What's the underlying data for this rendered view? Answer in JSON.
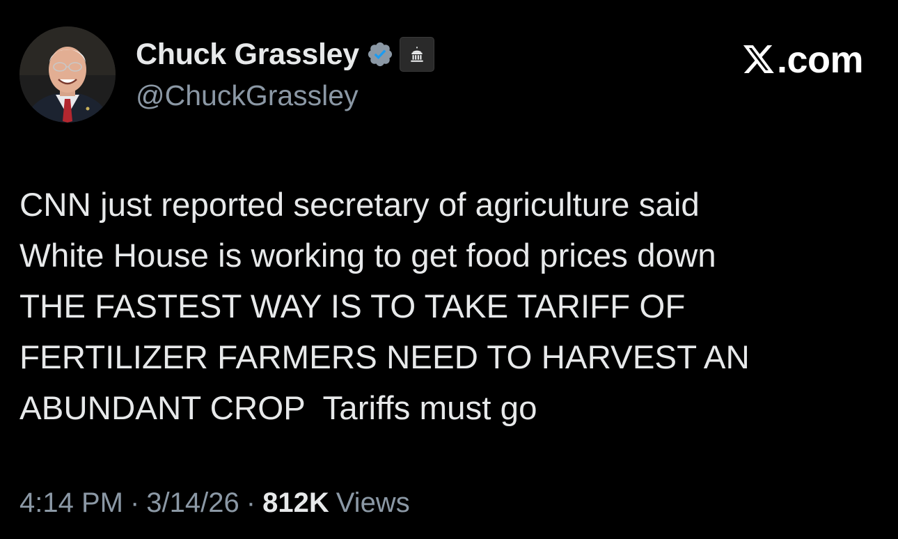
{
  "author": {
    "display_name": "Chuck Grassley",
    "handle": "@ChuckGrassley",
    "verified_badge": "verified-badge-icon",
    "affiliation_badge": "government-building-icon"
  },
  "brand": {
    "logo": "x-logo-icon",
    "text": ".com"
  },
  "tweet": {
    "lines": [
      "CNN just reported secretary of agriculture said",
      "White House is working to get food prices down",
      "THE FASTEST WAY IS TO TAKE TARIFF OF",
      "FERTILIZER FARMERS NEED TO HARVEST AN",
      "ABUNDANT CROP  Tariffs must go"
    ]
  },
  "meta": {
    "time": "4:14 PM",
    "separator": "·",
    "date": "3/14/26",
    "views_count": "812K",
    "views_label": "Views"
  },
  "colors": {
    "background": "#000000",
    "primary_text": "#e7e9ea",
    "secondary_text": "#8b98a5",
    "verified_blue": "#1d9bf0"
  }
}
